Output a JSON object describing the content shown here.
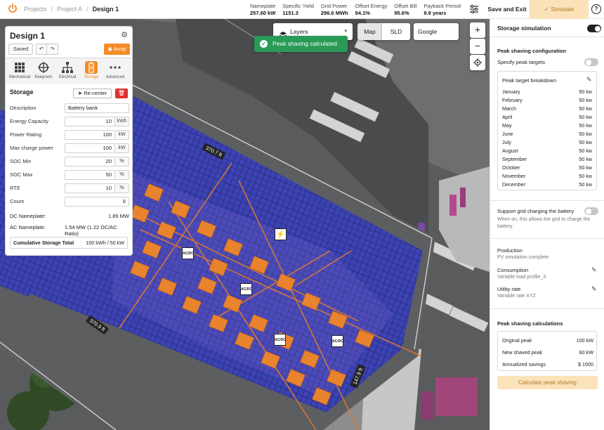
{
  "topbar": {
    "breadcrumbs": [
      "Projects",
      "Project A",
      "Design 1"
    ],
    "metrics": [
      {
        "label": "Nameplate",
        "value": "257.60 kW"
      },
      {
        "label": "Specific Yield",
        "value": "1151.3"
      },
      {
        "label": "Grid Power",
        "value": "296.6 MWh"
      },
      {
        "label": "Offset Energy",
        "value": "94.1%"
      },
      {
        "label": "Offset Bill",
        "value": "95.6%"
      },
      {
        "label": "Payback Period",
        "value": "8.9 years"
      }
    ],
    "save_exit": "Save and Exit",
    "simulate": "Simulate",
    "help": "?"
  },
  "map": {
    "layers_label": "Layers",
    "toast": "Peak shaving calculated",
    "map_btn": "Map",
    "sld_btn": "SLD",
    "google_btn": "Google",
    "dimensions": [
      "370.7 ft",
      "370.9 ft",
      "147.9 ft"
    ],
    "inverter_label": "AC/DC"
  },
  "design_panel": {
    "title": "Design 1",
    "saved": "Saved",
    "array": "Array",
    "tabs": [
      "Mechanical",
      "Keepouts",
      "Electrical",
      "Storage",
      "Advanced"
    ],
    "storage_title": "Storage",
    "recenter": "Re-center",
    "fields": [
      {
        "label": "Description",
        "value": "Battery bank",
        "unit": ""
      },
      {
        "label": "Energy Capacity",
        "value": "10",
        "unit": "kWh"
      },
      {
        "label": "Power Rating",
        "value": "100",
        "unit": "kW"
      },
      {
        "label": "Max charge power",
        "value": "100",
        "unit": "kW"
      },
      {
        "label": "SOC Min",
        "value": "20",
        "unit": "%"
      },
      {
        "label": "SOC Max",
        "value": "50",
        "unit": "%"
      },
      {
        "label": "RTE",
        "value": "10",
        "unit": "%"
      },
      {
        "label": "Count",
        "value": "6",
        "unit": ""
      }
    ],
    "dc_nameplate_label": "DC Nameplate:",
    "dc_nameplate_value": "1.89 MW",
    "ac_nameplate_label": "AC Nameplate:",
    "ac_nameplate_value": "1.54 MW  (1.22 DC/AC Ratio)",
    "cumulative_label": "Cumulative Storage Total",
    "cumulative_value": "100 kWh / 50 kW"
  },
  "sidebar": {
    "title": "Storage simulation",
    "peak_config_title": "Peak shaving configuration",
    "specify_targets": "Specify peak targets",
    "breakdown_title": "Peak target breakdown",
    "months": [
      {
        "month": "January",
        "value": "50 kw"
      },
      {
        "month": "February",
        "value": "50 kw"
      },
      {
        "month": "March",
        "value": "50 kw"
      },
      {
        "month": "April",
        "value": "50 kw"
      },
      {
        "month": "May",
        "value": "50 kw"
      },
      {
        "month": "June",
        "value": "50 kw"
      },
      {
        "month": "July",
        "value": "50 kw"
      },
      {
        "month": "August",
        "value": "50 kw"
      },
      {
        "month": "September",
        "value": "50 kw"
      },
      {
        "month": "October",
        "value": "50 kw"
      },
      {
        "month": "November",
        "value": "50 kw"
      },
      {
        "month": "December",
        "value": "50 kw"
      }
    ],
    "support_grid": "Support grid charging the battery",
    "support_grid_desc_1": "When on, this allows the grid to charge the",
    "support_grid_desc_2": "battery.",
    "production_label": "Production",
    "production_value": "PV simulation complete",
    "consumption_label": "Consumption",
    "consumption_value": "Variable load profile_3",
    "utility_label": "Utility rate",
    "utility_value": "Variable rate XYZ",
    "calc_title": "Peak shaving calculations",
    "calcs": [
      {
        "label": "Original peak",
        "value": "100 kW"
      },
      {
        "label": "New shaved peak",
        "value": "60 kW"
      },
      {
        "label": "Annualized savings",
        "value": "$ 1500"
      }
    ],
    "calc_button": "Calculate peak shaving"
  },
  "colors": {
    "accent": "#f28c28",
    "success": "#2a9a57",
    "danger": "#e0322f",
    "simulate_bg": "#fbe1b8"
  }
}
